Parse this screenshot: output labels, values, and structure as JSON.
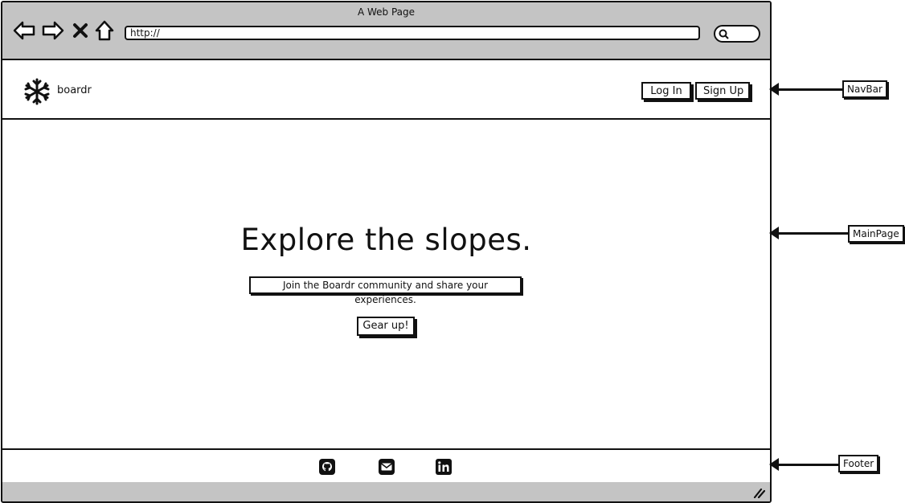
{
  "browser": {
    "window_title": "A Web Page",
    "address_value": "http://",
    "icons": [
      "back-arrow-icon",
      "forward-arrow-icon",
      "stop-icon",
      "home-icon",
      "search-icon"
    ]
  },
  "navbar": {
    "brand": "boardr",
    "logo_icon": "snowflake-icon",
    "login_label": "Log In",
    "signup_label": "Sign Up"
  },
  "main": {
    "headline": "Explore the slopes.",
    "tagline": "Join the Boardr community and share your experiences.",
    "cta_label": "Gear up!"
  },
  "footer": {
    "icons": [
      "github-icon",
      "mail-icon",
      "linkedin-icon"
    ]
  },
  "annotations": {
    "navbar": "NavBar",
    "mainpage": "MainPage",
    "footer": "Footer"
  }
}
